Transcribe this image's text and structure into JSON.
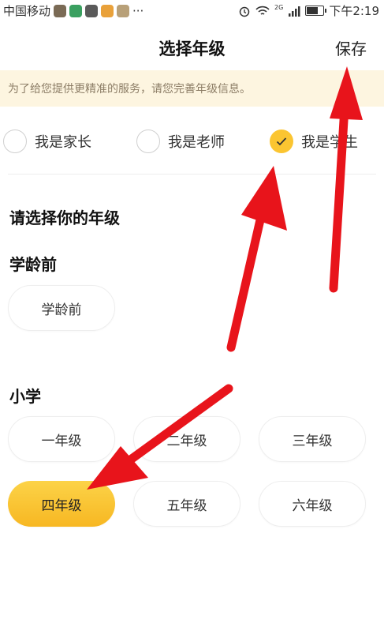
{
  "status": {
    "carrier": "中国移动",
    "time": "下午2:19",
    "network": "2G",
    "more": "···"
  },
  "nav": {
    "title": "选择年级",
    "save": "保存"
  },
  "notice": "为了给您提供更精准的服务，请您完善年级信息。",
  "roles": [
    {
      "label": "我是家长",
      "selected": false
    },
    {
      "label": "我是老师",
      "selected": false
    },
    {
      "label": "我是学生",
      "selected": true
    }
  ],
  "prompt": "请选择你的年级",
  "groups": {
    "preschool": {
      "title": "学龄前",
      "options": [
        "学龄前"
      ]
    },
    "primary": {
      "title": "小学",
      "options": [
        "一年级",
        "二年级",
        "三年级",
        "四年级",
        "五年级",
        "六年级"
      ],
      "selected": "四年级"
    }
  },
  "colors": {
    "accent": "#fbc531",
    "notice_bg": "#fdf5e0",
    "annotation_arrow": "#e8141b"
  }
}
